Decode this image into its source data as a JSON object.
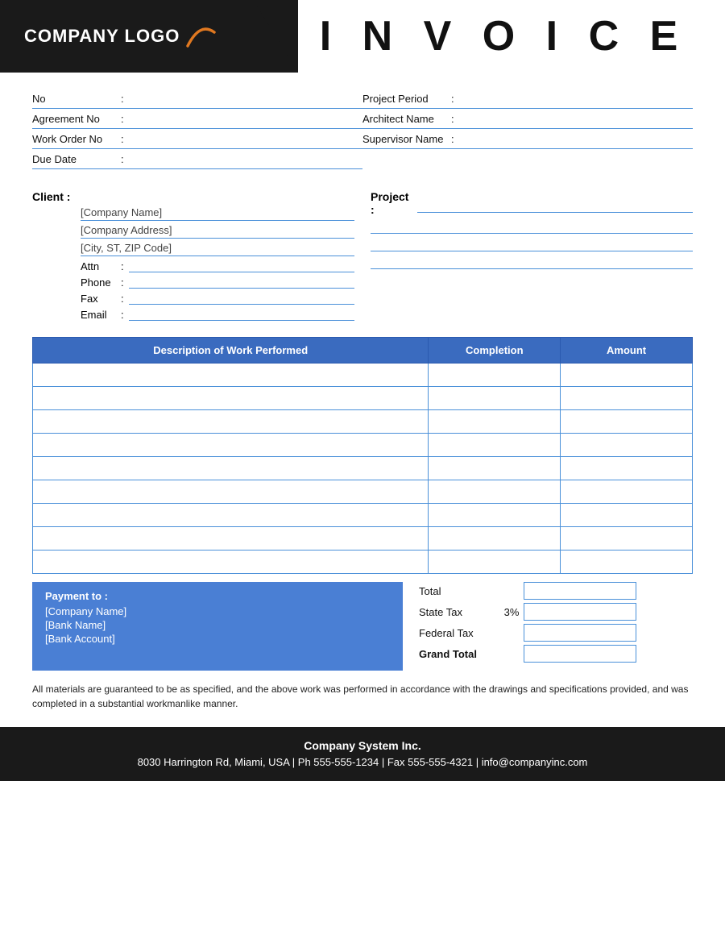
{
  "header": {
    "logo_text": "COMPANY LOGO",
    "invoice_title": "I N V O I C E"
  },
  "info_fields": {
    "left": [
      {
        "label": "No",
        "value": ""
      },
      {
        "label": "Agreement No",
        "value": ""
      },
      {
        "label": "Work Order No",
        "value": ""
      },
      {
        "label": "Due Date",
        "value": ""
      }
    ],
    "right": [
      {
        "label": "Project Period",
        "value": ""
      },
      {
        "label": "Architect Name",
        "value": ""
      },
      {
        "label": "Supervisor Name",
        "value": ""
      }
    ]
  },
  "client": {
    "label": "Client  :",
    "company_name": "[Company Name]",
    "company_address": "[Company Address]",
    "city_zip": "[City, ST, ZIP Code]",
    "attn_label": "Attn",
    "attn_value": "",
    "phone_label": "Phone",
    "phone_value": "",
    "fax_label": "Fax",
    "fax_value": "",
    "email_label": "Email",
    "email_value": ""
  },
  "project": {
    "label": "Project  :",
    "lines": [
      "",
      "",
      "",
      ""
    ]
  },
  "table": {
    "headers": [
      "Description of Work Performed",
      "Completion",
      "Amount"
    ],
    "rows": [
      {
        "description": "",
        "completion": "",
        "amount": ""
      },
      {
        "description": "",
        "completion": "",
        "amount": ""
      },
      {
        "description": "",
        "completion": "",
        "amount": ""
      },
      {
        "description": "",
        "completion": "",
        "amount": ""
      },
      {
        "description": "",
        "completion": "",
        "amount": ""
      },
      {
        "description": "",
        "completion": "",
        "amount": ""
      },
      {
        "description": "",
        "completion": "",
        "amount": ""
      },
      {
        "description": "",
        "completion": "",
        "amount": ""
      },
      {
        "description": "",
        "completion": "",
        "amount": ""
      }
    ]
  },
  "payment": {
    "title": "Payment to :",
    "company_name": "[Company Name]",
    "bank_name": "[Bank Name]",
    "bank_account": "[Bank Account]"
  },
  "totals": {
    "total_label": "Total",
    "state_tax_label": "State Tax",
    "state_tax_pct": "3%",
    "federal_tax_label": "Federal Tax",
    "grand_total_label": "Grand Total",
    "total_value": "",
    "state_tax_value": "",
    "federal_tax_value": "",
    "grand_total_value": ""
  },
  "disclaimer": "All materials are guaranteed to be as specified, and the above work was performed in accordance with the drawings and specifications provided, and was completed in a substantial workmanlike manner.",
  "footer": {
    "company": "Company System Inc.",
    "details": "8030 Harrington Rd, Miami, USA  |  Ph 555-555-1234  |  Fax 555-555-4321  |  info@companyinc.com"
  }
}
